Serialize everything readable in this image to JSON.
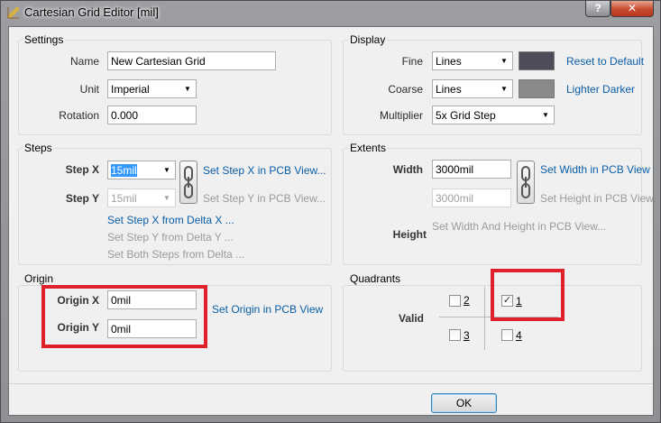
{
  "window": {
    "title": "Cartesian Grid Editor [mil]",
    "help_label": "?",
    "close_label": "✕"
  },
  "settings": {
    "title": "Settings",
    "name_label": "Name",
    "name_value": "New Cartesian Grid",
    "unit_label": "Unit",
    "unit_value": "Imperial",
    "rotation_label": "Rotation",
    "rotation_value": "0.000"
  },
  "display": {
    "title": "Display",
    "fine_label": "Fine",
    "fine_value": "Lines",
    "fine_color": "#4e4c58",
    "coarse_label": "Coarse",
    "coarse_value": "Lines",
    "coarse_color": "#8a8889",
    "multiplier_label": "Multiplier",
    "multiplier_value": "5x Grid Step",
    "reset_link": "Reset to Default",
    "lighter_darker_link": "Lighter Darker"
  },
  "steps": {
    "title": "Steps",
    "step_x_label": "Step X",
    "step_x_value": "15mil",
    "step_y_label": "Step Y",
    "step_y_value": "15mil",
    "set_step_x_link": "Set Step X in PCB View...",
    "set_step_y_link": "Set Step Y in PCB View...",
    "delta_x_link": "Set Step X from Delta X ...",
    "delta_y_link": "Set Step Y from Delta Y ...",
    "both_link": "Set Both Steps from Delta ..."
  },
  "extents": {
    "title": "Extents",
    "width_label": "Width",
    "width_value": "3000mil",
    "height_label": "Height",
    "height_value": "3000mil",
    "set_width_link": "Set Width in PCB View",
    "set_height_link": "Set Height in PCB View",
    "set_both_link": "Set Width And Height in PCB View..."
  },
  "origin": {
    "title": "Origin",
    "origin_x_label": "Origin X",
    "origin_x_value": "0mil",
    "origin_y_label": "Origin Y",
    "origin_y_value": "0mil",
    "set_origin_link": "Set Origin in PCB View"
  },
  "quadrants": {
    "title": "Quadrants",
    "valid_label": "Valid",
    "q1": "1",
    "q2": "2",
    "q3": "3",
    "q4": "4"
  },
  "footer": {
    "ok_label": "OK"
  },
  "colors": {
    "highlight": "#e0202a",
    "link": "#0a5ea8"
  }
}
